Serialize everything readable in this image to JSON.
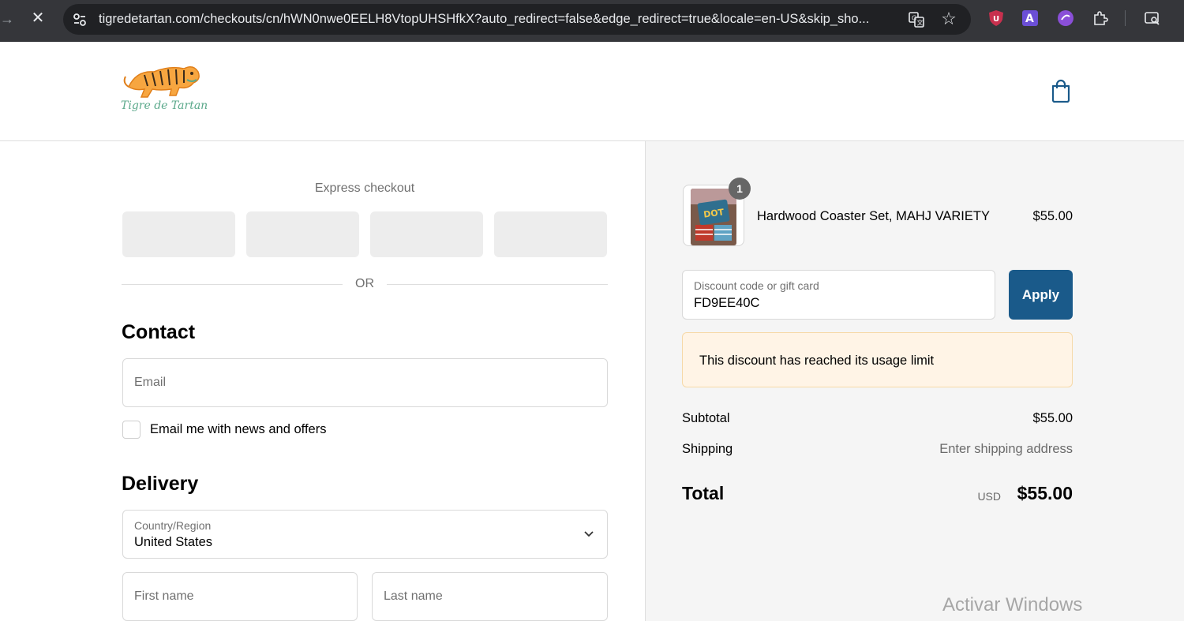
{
  "browser": {
    "url": "tigredetartan.com/checkouts/cn/hWN0nwe0EELH8VtopUHSHfkX?auto_redirect=false&edge_redirect=true&locale=en-US&skip_sho...",
    "stop_glyph": "✕",
    "star_glyph": "☆",
    "back_glyph": "→"
  },
  "header": {
    "logo_text": "Tigre de Tartan",
    "cart_icon": "shopping-bag-icon"
  },
  "express": {
    "title": "Express checkout",
    "or_text": "OR"
  },
  "contact": {
    "title": "Contact",
    "email_placeholder": "Email",
    "newsletter_label": "Email me with news and offers"
  },
  "delivery": {
    "title": "Delivery",
    "country_label": "Country/Region",
    "country_value": "United States",
    "first_name_placeholder": "First name",
    "last_name_placeholder": "Last name"
  },
  "summary": {
    "product": {
      "quantity": "1",
      "name": "Hardwood Coaster Set, MAHJ VARIETY",
      "price": "$55.00"
    },
    "discount": {
      "label": "Discount code or gift card",
      "value": "FD9EE40C",
      "apply_label": "Apply",
      "error": "This discount has reached its usage limit"
    },
    "subtotal_label": "Subtotal",
    "subtotal_value": "$55.00",
    "shipping_label": "Shipping",
    "shipping_value": "Enter shipping address",
    "total_label": "Total",
    "total_currency": "USD",
    "total_value": "$55.00"
  },
  "watermark": "Activar Windows",
  "colors": {
    "accent": "#1a5a8a",
    "alert_bg": "#fff4e6",
    "summary_bg": "#f5f5f5"
  }
}
